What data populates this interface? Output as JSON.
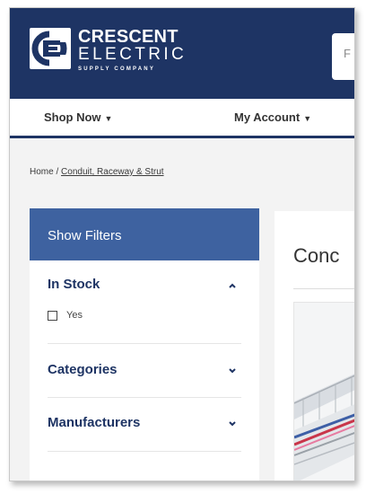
{
  "header": {
    "brand": {
      "line1": "CRESCENT",
      "line2": "ELECTRIC",
      "line3": "SUPPLY COMPANY"
    },
    "search_placeholder": "F",
    "colors": {
      "primary": "#1e3464",
      "filter_header": "#3e62a0"
    }
  },
  "nav": {
    "shop_now": "Shop Now",
    "my_account": "My Account",
    "caret_icon": "chevron-down-icon"
  },
  "breadcrumb": {
    "home": "Home",
    "separator": "/",
    "current": "Conduit, Raceway & Strut"
  },
  "filters": {
    "header": "Show Filters",
    "sections": [
      {
        "title": "In Stock",
        "expanded": true,
        "options": [
          {
            "label": "Yes",
            "checked": false
          }
        ]
      },
      {
        "title": "Categories",
        "expanded": false
      },
      {
        "title": "Manufacturers",
        "expanded": false
      }
    ]
  },
  "content": {
    "title": "Conc"
  }
}
